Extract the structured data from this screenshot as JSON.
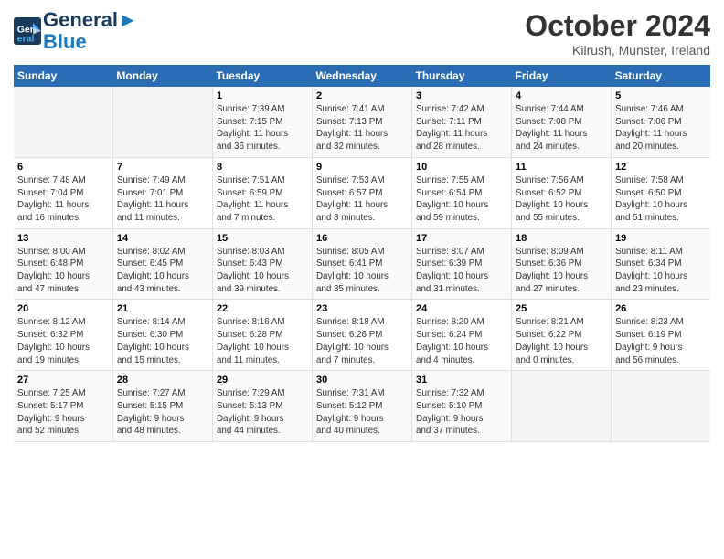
{
  "header": {
    "logo_line1": "General",
    "logo_line2": "Blue",
    "month_title": "October 2024",
    "location": "Kilrush, Munster, Ireland"
  },
  "columns": [
    "Sunday",
    "Monday",
    "Tuesday",
    "Wednesday",
    "Thursday",
    "Friday",
    "Saturday"
  ],
  "weeks": [
    {
      "cells": [
        {
          "day": "",
          "content": ""
        },
        {
          "day": "",
          "content": ""
        },
        {
          "day": "1",
          "content": "Sunrise: 7:39 AM\nSunset: 7:15 PM\nDaylight: 11 hours\nand 36 minutes."
        },
        {
          "day": "2",
          "content": "Sunrise: 7:41 AM\nSunset: 7:13 PM\nDaylight: 11 hours\nand 32 minutes."
        },
        {
          "day": "3",
          "content": "Sunrise: 7:42 AM\nSunset: 7:11 PM\nDaylight: 11 hours\nand 28 minutes."
        },
        {
          "day": "4",
          "content": "Sunrise: 7:44 AM\nSunset: 7:08 PM\nDaylight: 11 hours\nand 24 minutes."
        },
        {
          "day": "5",
          "content": "Sunrise: 7:46 AM\nSunset: 7:06 PM\nDaylight: 11 hours\nand 20 minutes."
        }
      ]
    },
    {
      "cells": [
        {
          "day": "6",
          "content": "Sunrise: 7:48 AM\nSunset: 7:04 PM\nDaylight: 11 hours\nand 16 minutes."
        },
        {
          "day": "7",
          "content": "Sunrise: 7:49 AM\nSunset: 7:01 PM\nDaylight: 11 hours\nand 11 minutes."
        },
        {
          "day": "8",
          "content": "Sunrise: 7:51 AM\nSunset: 6:59 PM\nDaylight: 11 hours\nand 7 minutes."
        },
        {
          "day": "9",
          "content": "Sunrise: 7:53 AM\nSunset: 6:57 PM\nDaylight: 11 hours\nand 3 minutes."
        },
        {
          "day": "10",
          "content": "Sunrise: 7:55 AM\nSunset: 6:54 PM\nDaylight: 10 hours\nand 59 minutes."
        },
        {
          "day": "11",
          "content": "Sunrise: 7:56 AM\nSunset: 6:52 PM\nDaylight: 10 hours\nand 55 minutes."
        },
        {
          "day": "12",
          "content": "Sunrise: 7:58 AM\nSunset: 6:50 PM\nDaylight: 10 hours\nand 51 minutes."
        }
      ]
    },
    {
      "cells": [
        {
          "day": "13",
          "content": "Sunrise: 8:00 AM\nSunset: 6:48 PM\nDaylight: 10 hours\nand 47 minutes."
        },
        {
          "day": "14",
          "content": "Sunrise: 8:02 AM\nSunset: 6:45 PM\nDaylight: 10 hours\nand 43 minutes."
        },
        {
          "day": "15",
          "content": "Sunrise: 8:03 AM\nSunset: 6:43 PM\nDaylight: 10 hours\nand 39 minutes."
        },
        {
          "day": "16",
          "content": "Sunrise: 8:05 AM\nSunset: 6:41 PM\nDaylight: 10 hours\nand 35 minutes."
        },
        {
          "day": "17",
          "content": "Sunrise: 8:07 AM\nSunset: 6:39 PM\nDaylight: 10 hours\nand 31 minutes."
        },
        {
          "day": "18",
          "content": "Sunrise: 8:09 AM\nSunset: 6:36 PM\nDaylight: 10 hours\nand 27 minutes."
        },
        {
          "day": "19",
          "content": "Sunrise: 8:11 AM\nSunset: 6:34 PM\nDaylight: 10 hours\nand 23 minutes."
        }
      ]
    },
    {
      "cells": [
        {
          "day": "20",
          "content": "Sunrise: 8:12 AM\nSunset: 6:32 PM\nDaylight: 10 hours\nand 19 minutes."
        },
        {
          "day": "21",
          "content": "Sunrise: 8:14 AM\nSunset: 6:30 PM\nDaylight: 10 hours\nand 15 minutes."
        },
        {
          "day": "22",
          "content": "Sunrise: 8:16 AM\nSunset: 6:28 PM\nDaylight: 10 hours\nand 11 minutes."
        },
        {
          "day": "23",
          "content": "Sunrise: 8:18 AM\nSunset: 6:26 PM\nDaylight: 10 hours\nand 7 minutes."
        },
        {
          "day": "24",
          "content": "Sunrise: 8:20 AM\nSunset: 6:24 PM\nDaylight: 10 hours\nand 4 minutes."
        },
        {
          "day": "25",
          "content": "Sunrise: 8:21 AM\nSunset: 6:22 PM\nDaylight: 10 hours\nand 0 minutes."
        },
        {
          "day": "26",
          "content": "Sunrise: 8:23 AM\nSunset: 6:19 PM\nDaylight: 9 hours\nand 56 minutes."
        }
      ]
    },
    {
      "cells": [
        {
          "day": "27",
          "content": "Sunrise: 7:25 AM\nSunset: 5:17 PM\nDaylight: 9 hours\nand 52 minutes."
        },
        {
          "day": "28",
          "content": "Sunrise: 7:27 AM\nSunset: 5:15 PM\nDaylight: 9 hours\nand 48 minutes."
        },
        {
          "day": "29",
          "content": "Sunrise: 7:29 AM\nSunset: 5:13 PM\nDaylight: 9 hours\nand 44 minutes."
        },
        {
          "day": "30",
          "content": "Sunrise: 7:31 AM\nSunset: 5:12 PM\nDaylight: 9 hours\nand 40 minutes."
        },
        {
          "day": "31",
          "content": "Sunrise: 7:32 AM\nSunset: 5:10 PM\nDaylight: 9 hours\nand 37 minutes."
        },
        {
          "day": "",
          "content": ""
        },
        {
          "day": "",
          "content": ""
        }
      ]
    }
  ]
}
